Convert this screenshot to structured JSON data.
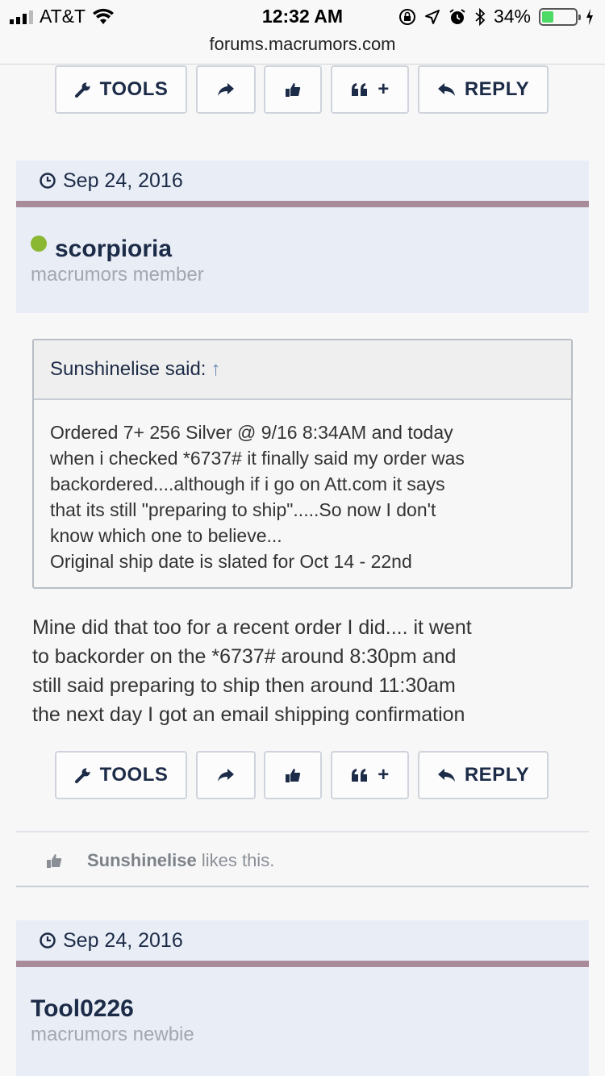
{
  "status_bar": {
    "carrier": "AT&T",
    "time": "12:32 AM",
    "battery_percent": "34%",
    "battery_level": 0.34
  },
  "url_bar": {
    "host": "forums.macrumors.com"
  },
  "post_actions": {
    "tools_label": "TOOLS",
    "reply_label": "REPLY",
    "quote_plus": "+"
  },
  "posts": [
    {
      "date": "Sep 24, 2016",
      "username": "scorpioria",
      "user_title": "macrumors member",
      "online": true,
      "quote": {
        "author_line": "Sunshinelise said:",
        "arrow": "↑",
        "lines": [
          "Ordered 7+ 256 Silver @ 9/16 8:34AM and today",
          "when i checked *6737# it finally said my order was",
          "backordered....although if i go on Att.com it says",
          "that its still \"preparing to ship\".....So now I don't",
          "know which one to believe...",
          "Original ship date is slated for Oct 14 - 22nd"
        ]
      },
      "body_lines": [
        "Mine did that too for a recent order I did.... it went",
        "to backorder on the *6737# around 8:30pm and",
        "still said preparing to ship then around 11:30am",
        "the next day I got an email shipping confirmation"
      ],
      "likes": {
        "user": "Sunshinelise",
        "text": " likes this."
      }
    },
    {
      "date": "Sep 24, 2016",
      "username": "Tool0226",
      "user_title": "macrumors newbie",
      "online": false
    }
  ],
  "colors": {
    "header_bg": "#e9eef6",
    "rule": "#a98a99",
    "online": "#8ab833",
    "text_dark": "#1c2b47"
  }
}
